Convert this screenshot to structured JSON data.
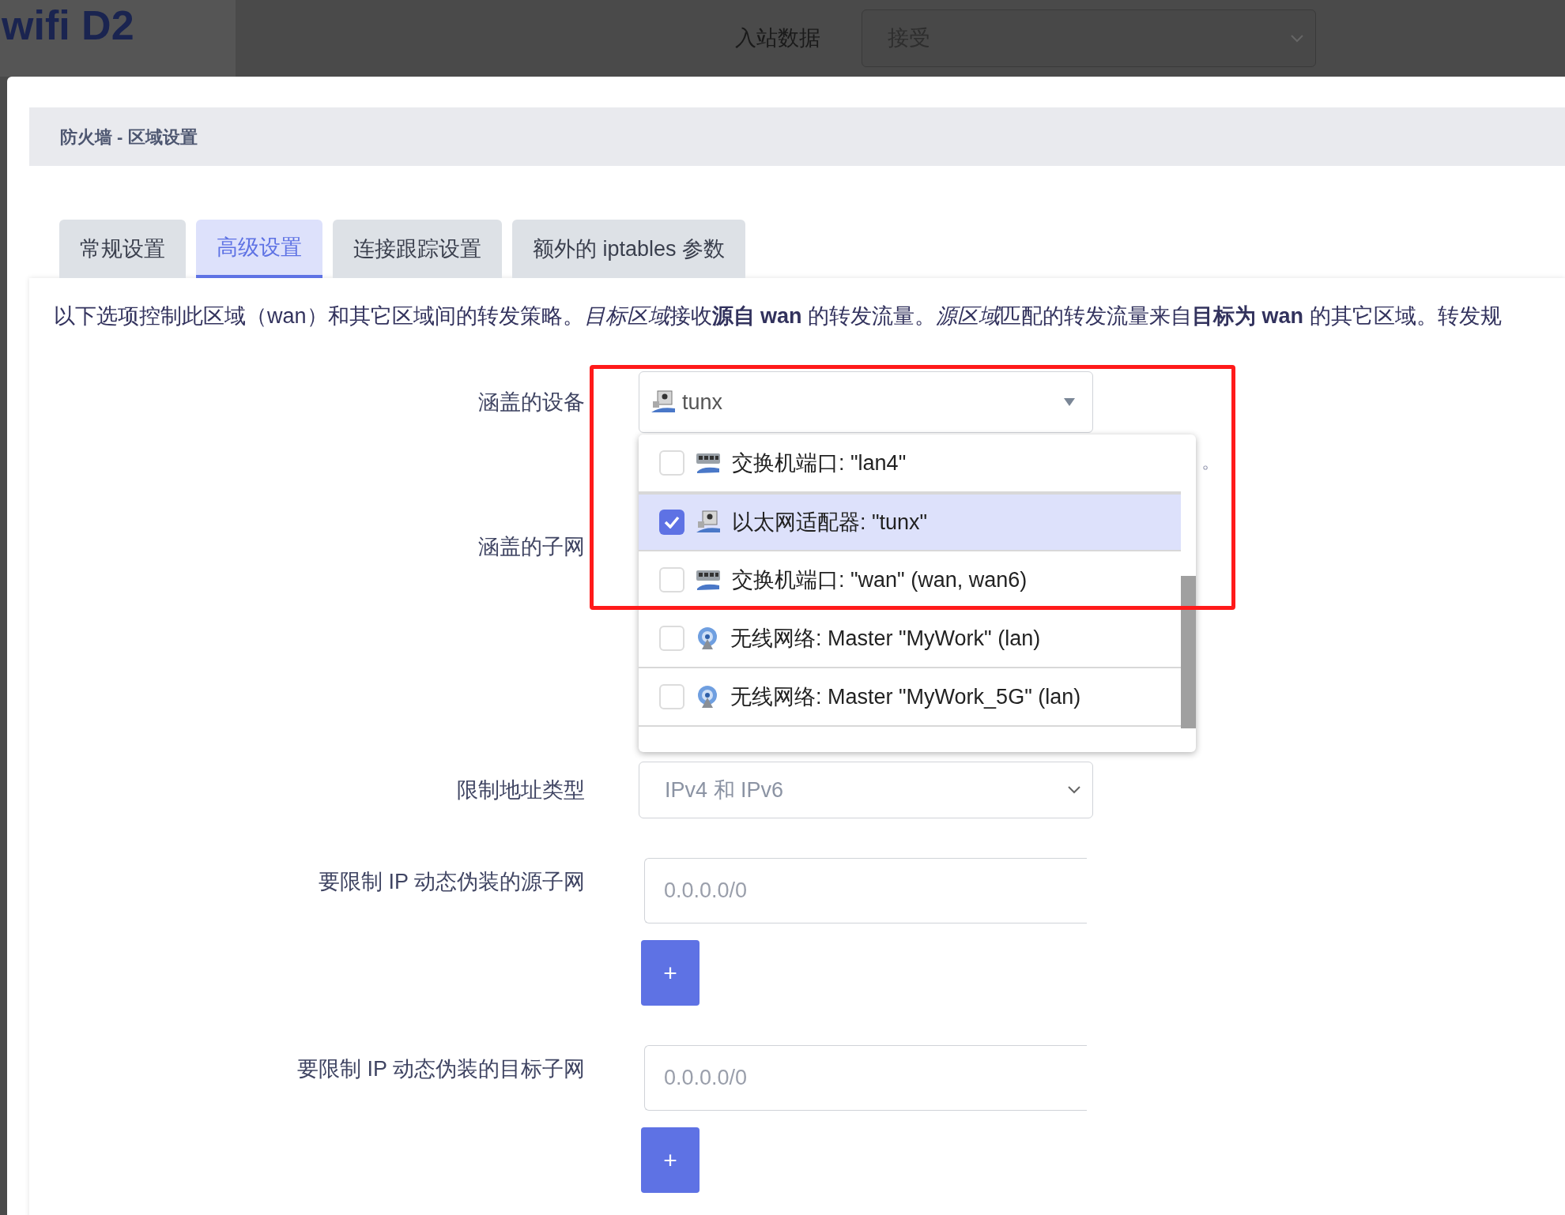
{
  "background": {
    "brand": "wifi D2",
    "field_label": "入站数据",
    "field_value": "接受"
  },
  "dialog": {
    "title": "防火墙 - 区域设置",
    "tabs": [
      {
        "label": "常规设置",
        "selected": false
      },
      {
        "label": "高级设置",
        "selected": true
      },
      {
        "label": "连接跟踪设置",
        "selected": false
      },
      {
        "label": "额外的 iptables 参数",
        "selected": false
      }
    ],
    "description": [
      "以下选项控制此区域（wan）和其它区域间的转发策略。",
      "*目标区域*",
      "接收**源自 wan** 的转发流量。",
      "*源区域*",
      "匹配的转发流量来自**目标为 wan** 的其它区域。转发规"
    ],
    "fields": [
      {
        "kind": "device-select",
        "label": "涵盖的设备",
        "value": "tunx",
        "hint": "。",
        "options": [
          {
            "kind": "switch",
            "label": "交换机端口: \"lan4\"",
            "checked": false
          },
          {
            "kind": "adapter",
            "label": "以太网适配器: \"tunx\"",
            "checked": true
          },
          {
            "kind": "switch",
            "label": "交换机端口: \"wan\" (wan, wan6)",
            "checked": false
          },
          {
            "kind": "wireless",
            "label": "无线网络: Master \"MyWork\" (lan)",
            "checked": false
          },
          {
            "kind": "wireless",
            "label": "无线网络: Master \"MyWork_5G\" (lan)",
            "checked": false
          }
        ]
      },
      {
        "kind": "hidden",
        "label": "涵盖的子网"
      },
      {
        "kind": "select",
        "label": "限制地址类型",
        "value": "IPv4 和 IPv6"
      },
      {
        "kind": "list-input",
        "label": "要限制 IP 动态伪装的源子网",
        "placeholder": "0.0.0.0/0",
        "button": "+"
      },
      {
        "kind": "list-input",
        "label": "要限制 IP 动态伪装的目标子网",
        "placeholder": "0.0.0.0/0",
        "button": "+"
      }
    ]
  }
}
